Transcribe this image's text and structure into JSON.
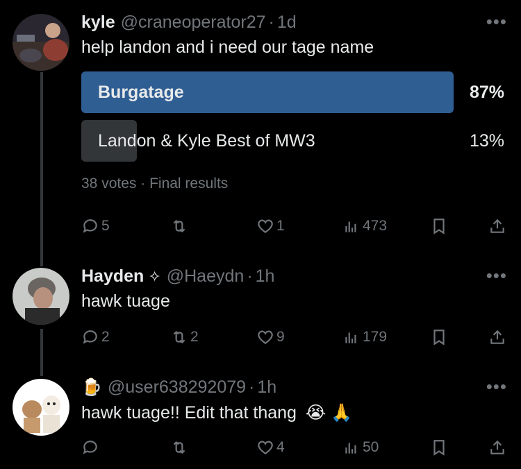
{
  "tweets": [
    {
      "name": "kyle",
      "handle": "@craneoperator27",
      "time": "1d",
      "text": "help landon and i need our tage name",
      "poll": {
        "options": [
          {
            "label": "Burgatage",
            "percent": "87%",
            "fraction": 0.87,
            "winner": true
          },
          {
            "label": "Landon & Kyle Best of MW3",
            "percent": "13%",
            "fraction": 0.13,
            "winner": false
          }
        ],
        "votes": "38 votes",
        "status": "Final results"
      },
      "actions": {
        "replies": "5",
        "retweets": "",
        "likes": "1",
        "views": "473"
      }
    },
    {
      "name": "Hayden",
      "badge": "✧",
      "handle": "@Haeydn",
      "time": "1h",
      "text": "hawk tuage",
      "actions": {
        "replies": "2",
        "retweets": "2",
        "likes": "9",
        "views": "179"
      }
    },
    {
      "name_emoji": "🍺",
      "handle": "@user638292079",
      "time": "1h",
      "text": "hawk tuage!! Edit that thang",
      "text_emoji": "😭 🙏",
      "actions": {
        "replies": "",
        "retweets": "",
        "likes": "4",
        "views": "50"
      }
    }
  ],
  "separator": "·",
  "more_label": "•••",
  "colors": {
    "accent": "#2f5e93",
    "muted": "#71767b",
    "poll_loser": "#333639"
  }
}
